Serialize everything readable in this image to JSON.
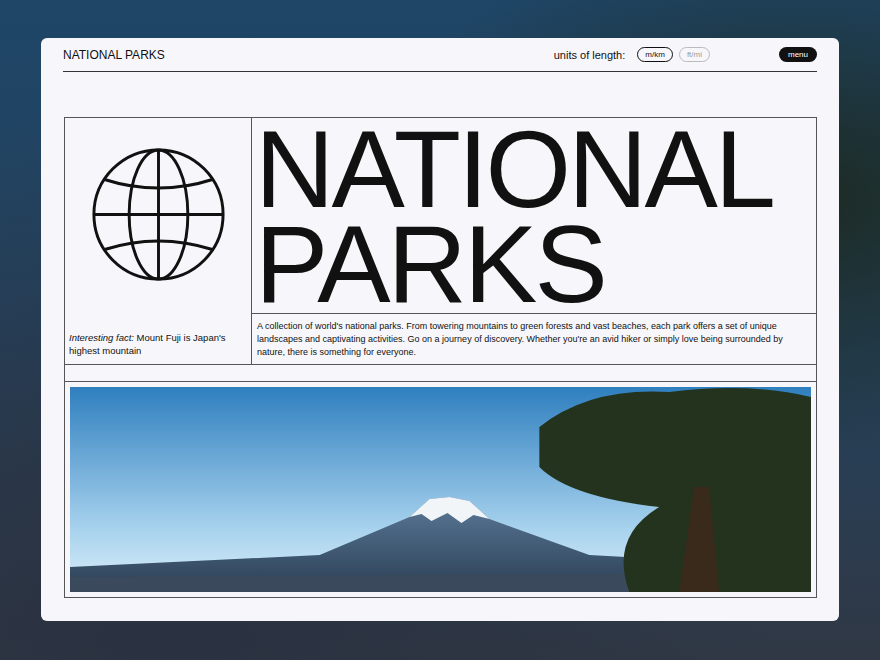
{
  "header": {
    "title": "NATIONAL PARKS",
    "units_label": "units of length:",
    "units": [
      {
        "label": "m/km",
        "selected": true
      },
      {
        "label": "ft/mi",
        "selected": false
      }
    ],
    "menu": "menu"
  },
  "hero": {
    "title": "NATIONAL PARKS",
    "fact_label": "Interesting fact:",
    "fact_text": "Mount Fuji is Japan's highest mountain",
    "description": "A collection of world's national parks. From towering mountains to green forests and vast beaches, each park offers a set of unique landscapes and captivating activities. Go on a journey of discovery. Whether you're an avid hiker or simply love being surrounded by nature, there is something for everyone."
  }
}
